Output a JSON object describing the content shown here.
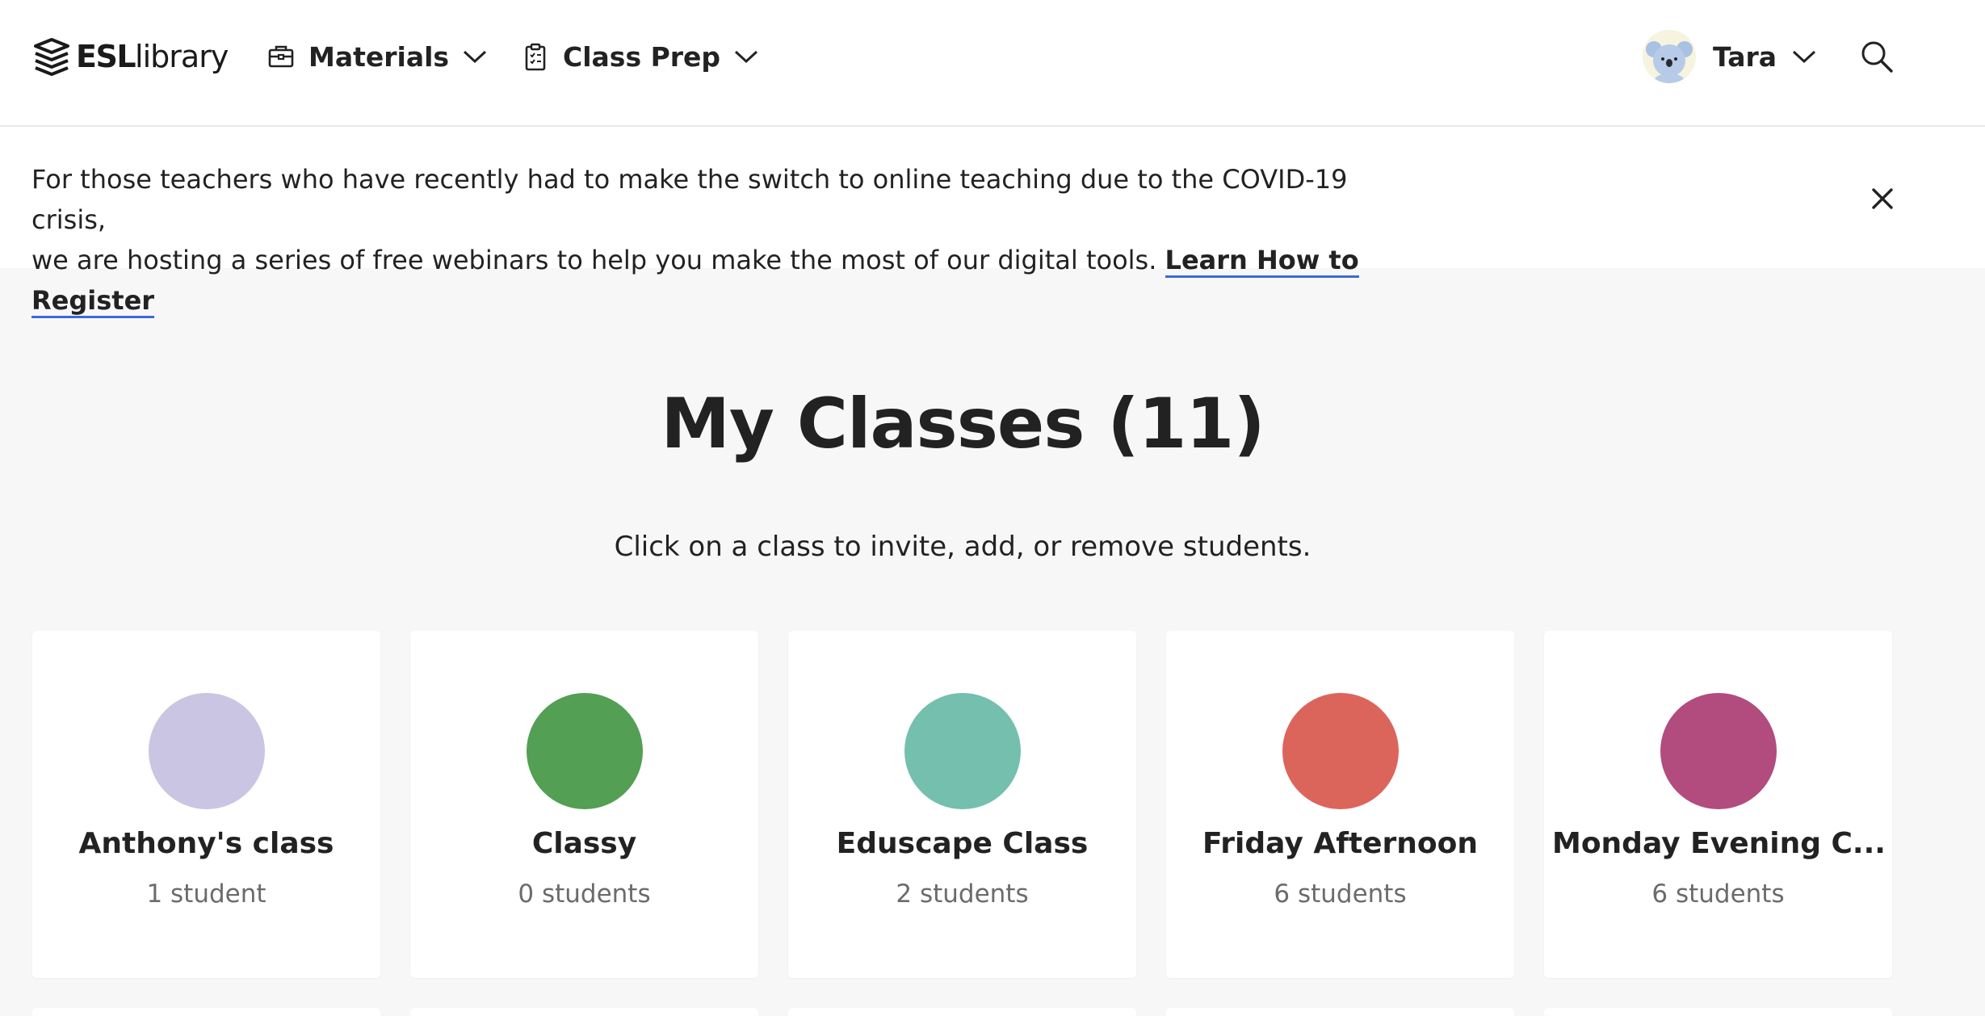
{
  "header": {
    "logo": {
      "bold": "ESL",
      "light": "library"
    },
    "nav": [
      {
        "label": "Materials",
        "icon": "briefcase-icon"
      },
      {
        "label": "Class Prep",
        "icon": "clipboard-icon"
      }
    ],
    "user": {
      "name": "Tara",
      "avatar": "koala-avatar"
    },
    "search_icon": "search-icon"
  },
  "banner": {
    "line1": "For those teachers who have recently had to make the switch to online teaching due to the COVID-19 crisis,",
    "line2": "we are hosting a series of free webinars to help you make the most of our digital tools.",
    "link": "Learn How to Register",
    "link_underline_color": "#3e6ad6"
  },
  "main": {
    "title": "My Classes (11)",
    "subtitle": "Click on a class to invite, add, or remove students."
  },
  "classes": [
    {
      "name": "Anthony's class",
      "count": "1 student",
      "color": "#c9c5e2"
    },
    {
      "name": "Classy",
      "count": "0 students",
      "color": "#539f54"
    },
    {
      "name": "Eduscape Class",
      "count": "2 students",
      "color": "#74bfae"
    },
    {
      "name": "Friday Afternoon",
      "count": "6 students",
      "color": "#dc655b"
    },
    {
      "name": "Monday Evening C...",
      "count": "6 students",
      "color": "#b24c7e"
    }
  ]
}
